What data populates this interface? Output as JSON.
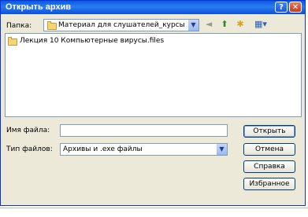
{
  "window": {
    "title": "Открыть архив",
    "help_label": "?",
    "close_label": "✕"
  },
  "toolbar": {
    "folder_label": "Папка:",
    "folder_value": "Материал для слушателей_курсы",
    "icons": [
      "back-icon",
      "up-folder-icon",
      "new-folder-icon",
      "view-menu-icon"
    ]
  },
  "files": [
    {
      "name": "Лекция 10 Компьютерные вирусы.files",
      "icon": "folder-icon"
    }
  ],
  "form": {
    "filename_label": "Имя файла:",
    "filename_value": "",
    "filetype_label": "Тип файлов:",
    "filetype_value": "Архивы и .exe файлы"
  },
  "buttons": {
    "open": "Открыть",
    "cancel": "Отмена",
    "help": "Справка",
    "favorites": "Избранное"
  }
}
